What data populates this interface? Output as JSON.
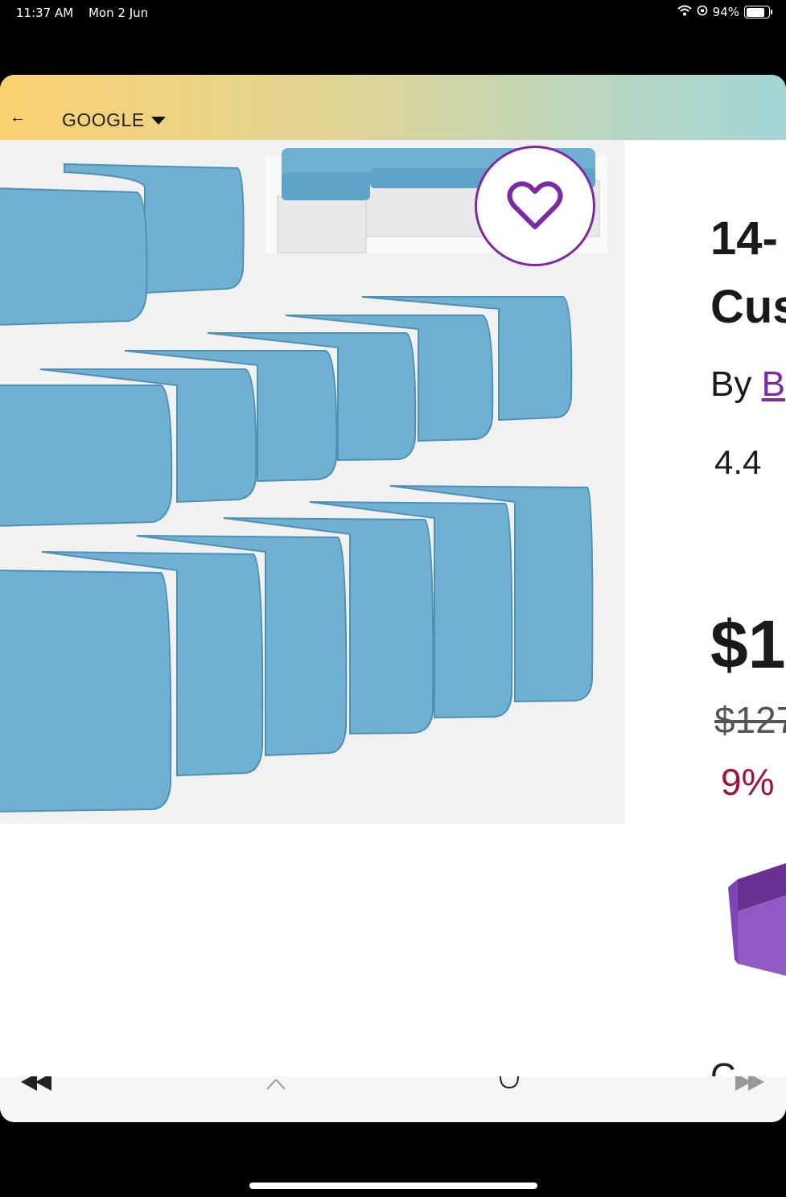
{
  "status_bar": {
    "time": "11:37 AM",
    "date": "Mon 2 Jun",
    "battery": "94%",
    "battery_level": 0.94
  },
  "browser": {
    "back_label": "←",
    "source": "GOOGLE"
  },
  "product": {
    "title_line1": "14-",
    "title_line2": "Cus",
    "by_prefix": "By",
    "brand": "B",
    "rating": "4.4",
    "price": "$1",
    "original_price": "$127",
    "discount": "9% ("
  },
  "partial_section_label": "C",
  "colors": {
    "accent": "#7a2aa3",
    "discount": "#9c1238",
    "cushion": "#6fb0d3"
  },
  "icons": [
    "back-arrow-icon",
    "caret-down-icon",
    "heart-icon",
    "wifi-icon",
    "battery-icon",
    "rewind-icon",
    "close-icon",
    "reload-icon",
    "forward-icon"
  ]
}
